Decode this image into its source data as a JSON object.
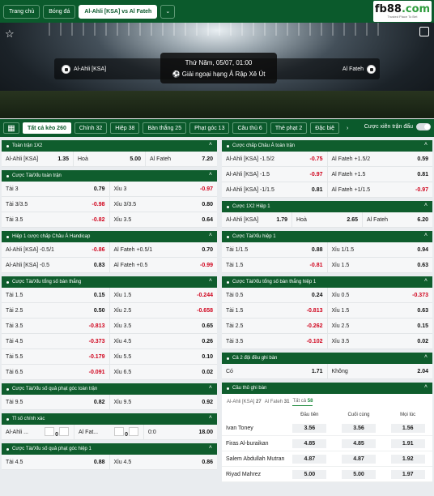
{
  "topbar": {
    "home": "Trang chủ",
    "football": "Bóng đá",
    "match": "Al-Ahli [KSA] vs Al Fateh"
  },
  "logo": {
    "text": "fb88",
    "domain": ".com",
    "tagline": "Trusted Place To Bet"
  },
  "match": {
    "home": "Al-Ahli [KSA]",
    "away": "Al Fateh",
    "time": "Thứ Năm, 05/07, 01:00",
    "league": "Giải ngoại hạng Ả Rập Xê Út"
  },
  "tabs": [
    {
      "label": "Tất cả kèo 260"
    },
    {
      "label": "Chính 32"
    },
    {
      "label": "Hiệp 38"
    },
    {
      "label": "Bàn thắng 25"
    },
    {
      "label": "Phạt góc 13"
    },
    {
      "label": "Câu thủ 6"
    },
    {
      "label": "Thẻ phạt 2"
    },
    {
      "label": "Đặc biệ"
    }
  ],
  "combo_label": "Cược xiên trận đấu",
  "left": {
    "fulltime_1x2": {
      "title": "Toàn trận 1X2",
      "cells": [
        [
          "Al-Ahli [KSA]",
          "1.35"
        ],
        [
          "Hoà",
          "5.00"
        ],
        [
          "Al Fateh",
          "7.20"
        ]
      ]
    },
    "ou_full": {
      "title": "Cược Tài/Xỉu toàn trận",
      "rows": [
        [
          [
            "Tài 3",
            "0.79"
          ],
          [
            "Xỉu 3",
            "-0.97"
          ]
        ],
        [
          [
            "Tài 3/3.5",
            "-0.98"
          ],
          [
            "Xỉu 3/3.5",
            "0.80"
          ]
        ],
        [
          [
            "Tài 3.5",
            "-0.82"
          ],
          [
            "Xỉu 3.5",
            "0.64"
          ]
        ]
      ]
    },
    "h1_handicap": {
      "title": "Hiệp 1 cược chấp Châu Á Handicap",
      "rows": [
        [
          [
            "Al-Ahli [KSA] -0.5/1",
            "-0.86"
          ],
          [
            "Al Fateh +0.5/1",
            "0.70"
          ]
        ],
        [
          [
            "Al-Ahli [KSA] -0.5",
            "0.83"
          ],
          [
            "Al Fateh +0.5",
            "-0.99"
          ]
        ]
      ]
    },
    "ou_goals": {
      "title": "Cược Tài/Xỉu tổng số bàn thắng",
      "rows": [
        [
          [
            "Tài 1.5",
            "0.15"
          ],
          [
            "Xỉu 1.5",
            "-0.244"
          ]
        ],
        [
          [
            "Tài 2.5",
            "0.50"
          ],
          [
            "Xỉu 2.5",
            "-0.658"
          ]
        ],
        [
          [
            "Tài 3.5",
            "-0.813"
          ],
          [
            "Xỉu 3.5",
            "0.65"
          ]
        ],
        [
          [
            "Tài 4.5",
            "-0.373"
          ],
          [
            "Xỉu 4.5",
            "0.26"
          ]
        ],
        [
          [
            "Tài 5.5",
            "-0.179"
          ],
          [
            "Xỉu 5.5",
            "0.10"
          ]
        ],
        [
          [
            "Tài 6.5",
            "-0.091"
          ],
          [
            "Xỉu 6.5",
            "0.02"
          ]
        ]
      ]
    },
    "ou_corners": {
      "title": "Cược Tài/Xỉu số quả phạt góc toàn trận",
      "rows": [
        [
          [
            "Tài 9.5",
            "0.82"
          ],
          [
            "Xỉu 9.5",
            "0.92"
          ]
        ]
      ]
    },
    "exact_score": {
      "title": "Tỉ số chính xác",
      "home": "Al-Ahli ...",
      "home_score": "0",
      "away": "Al Fat...",
      "away_score": "0",
      "score": "0:0",
      "odd": "18.00"
    },
    "ou_corners_h1": {
      "title": "Cược Tài/Xỉu số quả phạt góc hiệp 1",
      "rows": [
        [
          [
            "Tài 4.5",
            "0.88"
          ],
          [
            "Xỉu 4.5",
            "0.86"
          ]
        ]
      ]
    }
  },
  "right": {
    "ah_full": {
      "title": "Cược chấp Châu Á toàn trận",
      "rows": [
        [
          [
            "Al-Ahli [KSA] -1.5/2",
            "-0.75"
          ],
          [
            "Al Fateh +1.5/2",
            "0.59"
          ]
        ],
        [
          [
            "Al-Ahli [KSA] -1.5",
            "-0.97"
          ],
          [
            "Al Fateh +1.5",
            "0.81"
          ]
        ],
        [
          [
            "Al-Ahli [KSA] -1/1.5",
            "0.81"
          ],
          [
            "Al Fateh +1/1.5",
            "-0.97"
          ]
        ]
      ]
    },
    "h1_1x2": {
      "title": "Cược 1X2 Hiệp 1",
      "cells": [
        [
          "Al-Ahli [KSA]",
          "1.79"
        ],
        [
          "Hoà",
          "2.65"
        ],
        [
          "Al Fateh",
          "6.20"
        ]
      ]
    },
    "ou_h1": {
      "title": "Cược Tài/Xỉu hiệp 1",
      "rows": [
        [
          [
            "Tài 1/1.5",
            "0.88"
          ],
          [
            "Xỉu 1/1.5",
            "0.94"
          ]
        ],
        [
          [
            "Tài 1.5",
            "-0.81"
          ],
          [
            "Xỉu 1.5",
            "0.63"
          ]
        ]
      ]
    },
    "ou_goals_h1": {
      "title": "Cược Tài/Xỉu tổng số bàn thắng hiệp 1",
      "rows": [
        [
          [
            "Tài 0.5",
            "0.24"
          ],
          [
            "Xỉu 0.5",
            "-0.373"
          ]
        ],
        [
          [
            "Tài 1.5",
            "-0.813"
          ],
          [
            "Xỉu 1.5",
            "0.63"
          ]
        ],
        [
          [
            "Tài 2.5",
            "-0.262"
          ],
          [
            "Xỉu 2.5",
            "0.15"
          ]
        ],
        [
          [
            "Tài 3.5",
            "-0.102"
          ],
          [
            "Xỉu 3.5",
            "0.02"
          ]
        ]
      ]
    },
    "btts": {
      "title": "Cả 2 đội đều ghi bàn",
      "cells": [
        [
          "Có",
          "1.71"
        ],
        [
          "Không",
          "2.04"
        ]
      ]
    },
    "scorers": {
      "title": "Cầu thủ ghi bàn",
      "tabs": [
        {
          "label": "Al-Ahli [KSA]",
          "count": "27"
        },
        {
          "label": "Al Fateh",
          "count": "31"
        },
        {
          "label": "Tất cả",
          "count": "58"
        }
      ],
      "headers": [
        "Đầu tiên",
        "Cuối cùng",
        "Mọi lúc"
      ],
      "rows": [
        [
          "Ivan Toney",
          "3.56",
          "3.56",
          "1.56"
        ],
        [
          "Firas Al-buraikan",
          "4.85",
          "4.85",
          "1.91"
        ],
        [
          "Salem Abdullah Mutran",
          "4.87",
          "4.87",
          "1.92"
        ],
        [
          "Riyad Mahrez",
          "5.00",
          "5.00",
          "1.97"
        ]
      ]
    }
  }
}
